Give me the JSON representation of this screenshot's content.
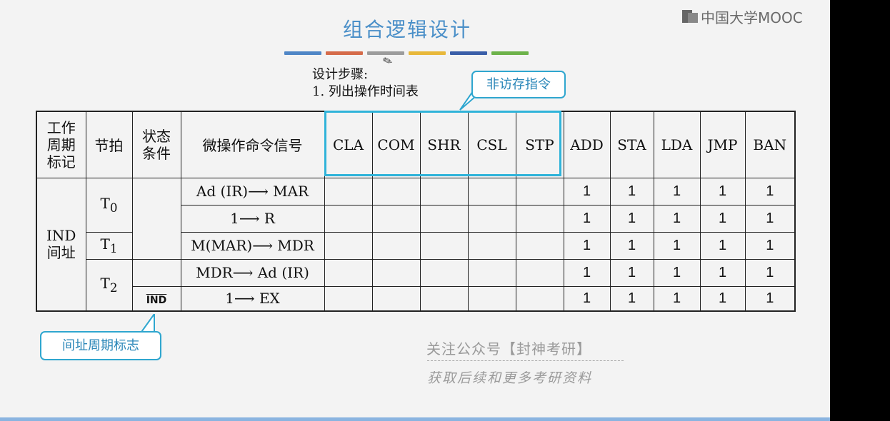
{
  "title": "组合逻辑设计",
  "logo": "中国大学MOOC",
  "accent_colors": [
    "#4f86c6",
    "#d56b4a",
    "#9c9c9c",
    "#e8b83a",
    "#3a5ea8",
    "#6db24a"
  ],
  "steps": {
    "line1": "设计步骤:",
    "line2": "1.  列出操作时间表"
  },
  "callout_top": "非访存指令",
  "callout_bottom": "间址周期标志",
  "table": {
    "headers": {
      "cycle": [
        "工作",
        "周期",
        "标记"
      ],
      "beat": "节拍",
      "cond": [
        "状态",
        "条件"
      ],
      "signal": "微操作命令信号",
      "instructions": [
        "CLA",
        "COM",
        "SHR",
        "CSL",
        "STP",
        "ADD",
        "STA",
        "LDA",
        "JMP",
        "BAN"
      ]
    },
    "cycle_label": [
      "IND",
      "间址"
    ],
    "beats": {
      "t0": "T",
      "t0_sub": "0",
      "t1": "T",
      "t1_sub": "1",
      "t2": "T",
      "t2_sub": "2"
    },
    "cond_ind": "IND",
    "rows": [
      {
        "signal": "Ad (IR)⟶ MAR",
        "values": [
          "",
          "",
          "",
          "",
          "",
          "1",
          "1",
          "1",
          "1",
          "1"
        ]
      },
      {
        "signal": "1⟶ R",
        "values": [
          "",
          "",
          "",
          "",
          "",
          "1",
          "1",
          "1",
          "1",
          "1"
        ]
      },
      {
        "signal": "M(MAR)⟶ MDR",
        "values": [
          "",
          "",
          "",
          "",
          "",
          "1",
          "1",
          "1",
          "1",
          "1"
        ]
      },
      {
        "signal": "MDR⟶ Ad (IR)",
        "values": [
          "",
          "",
          "",
          "",
          "",
          "1",
          "1",
          "1",
          "1",
          "1"
        ]
      },
      {
        "signal": "1⟶ EX",
        "values": [
          "",
          "",
          "",
          "",
          "",
          "1",
          "1",
          "1",
          "1",
          "1"
        ]
      }
    ]
  },
  "watermark": {
    "line1": "关注公众号【封神考研】",
    "line2": "获取后续和更多考研资料"
  }
}
